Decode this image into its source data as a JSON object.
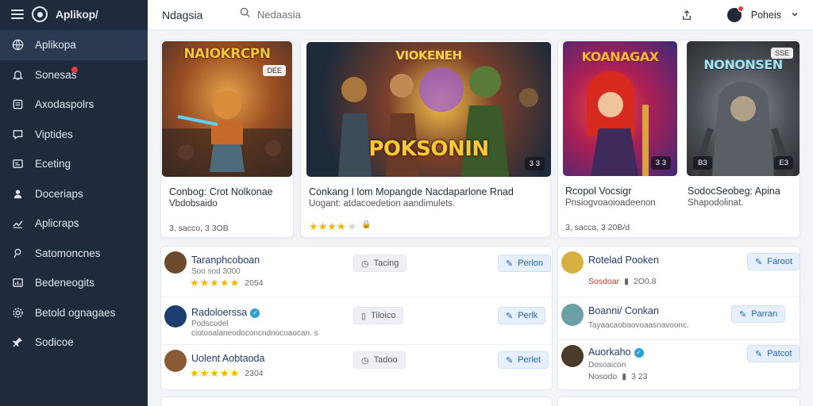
{
  "app": {
    "name": "Aplikop/"
  },
  "sidebar": {
    "items": [
      {
        "label": "Aplikopa",
        "icon": "globe-icon",
        "active": true
      },
      {
        "label": "Sonesas",
        "icon": "bell-icon",
        "badge": true
      },
      {
        "label": "Axodaspolrs",
        "icon": "document-icon"
      },
      {
        "label": "Viptides",
        "icon": "chat-icon"
      },
      {
        "label": "Eceting",
        "icon": "calendar-icon"
      },
      {
        "label": "Doceriaps",
        "icon": "users-icon"
      },
      {
        "label": "Aplicraps",
        "icon": "trend-icon"
      },
      {
        "label": "Satomoncnes",
        "icon": "person-icon"
      },
      {
        "label": "Bedeneogits",
        "icon": "chart-icon"
      },
      {
        "label": "Betold ognagaes",
        "icon": "gear-icon"
      },
      {
        "label": "Sodicoe",
        "icon": "pin-icon"
      }
    ]
  },
  "topbar": {
    "title": "Ndagsia",
    "search_placeholder": "Nedaasia",
    "user_name": "Poheis"
  },
  "featured": [
    {
      "art_title": "NAIOKRCPN",
      "tag": "DEE",
      "title": "Conbog: Crot Nolkonae",
      "subtitle": "Vbdobsaido",
      "meta": "3, sacco, 3 3OB",
      "colors": [
        "#7b3a1f",
        "#e7a34b",
        "#2b5f8e"
      ]
    },
    {
      "art_title": "POKSONIN",
      "banner": "VIOKENEH",
      "count": "3 3",
      "title": "Conkang I lom Mopangde Nacdaparlone Rnad",
      "subtitle": "Uogant: atdacoedetion aandimulets.",
      "stars": 4.5,
      "colors": [
        "#1c2a3a",
        "#e0b23a",
        "#5a2f7a"
      ]
    },
    {
      "art_title": "KOANAGAX",
      "count": "3 3",
      "title": "Rcopol Vocsigr",
      "subtitle": "Pnsiogvoaoioadeenon",
      "meta": "3, sacca, 3 20B/d",
      "colors": [
        "#c21f4a",
        "#f1a01a",
        "#5b2c82"
      ]
    },
    {
      "art_title": "NONONSEN",
      "tag": "SSE",
      "count": "B3",
      "count2": "E3",
      "title": "SodocSeobeg: Apina",
      "subtitle": "Shapodolinat.",
      "colors": [
        "#3a3f44",
        "#8d9298",
        "#5a5f66"
      ]
    }
  ],
  "list_left": [
    {
      "name": "Taranphcoboan",
      "sub": "Soo sod 3000",
      "stars": "★★★★★",
      "meta": "2054",
      "action1": "Tacing",
      "action2": "Perlon",
      "avatar": "#6b4a2e"
    },
    {
      "name": "Radoloerssa",
      "verified": true,
      "sub": "Podscodel",
      "sub2": "ciotooalaneodoconcndnocoaocan. s",
      "action1": "Tiloico",
      "action2": "Perlk",
      "avatar": "#1a3f6e"
    },
    {
      "name": "Uolent Aobtaoda",
      "stars": "★★★★★",
      "meta": "2304",
      "action1": "Tadoo",
      "action2": "Perlet",
      "avatar": "#8a5a35"
    }
  ],
  "list_right": [
    {
      "name": "Rotelad Pooken",
      "sub": "Sosdoar",
      "meta": "2O0.8",
      "action1": "Faroot",
      "avatar": "#d6b040"
    },
    {
      "name": "Boanni/ Conkan",
      "sub": "Tayaacaobaovoaasnavoonc.",
      "action1": "Parran",
      "avatar": "#6aa0a6"
    },
    {
      "name": "Auorkaho",
      "verified": true,
      "sub": "Dosoaicon",
      "sub2": "Nosodo",
      "meta": "3 23",
      "action1": "Patcot",
      "avatar": "#4a3b2a"
    }
  ]
}
